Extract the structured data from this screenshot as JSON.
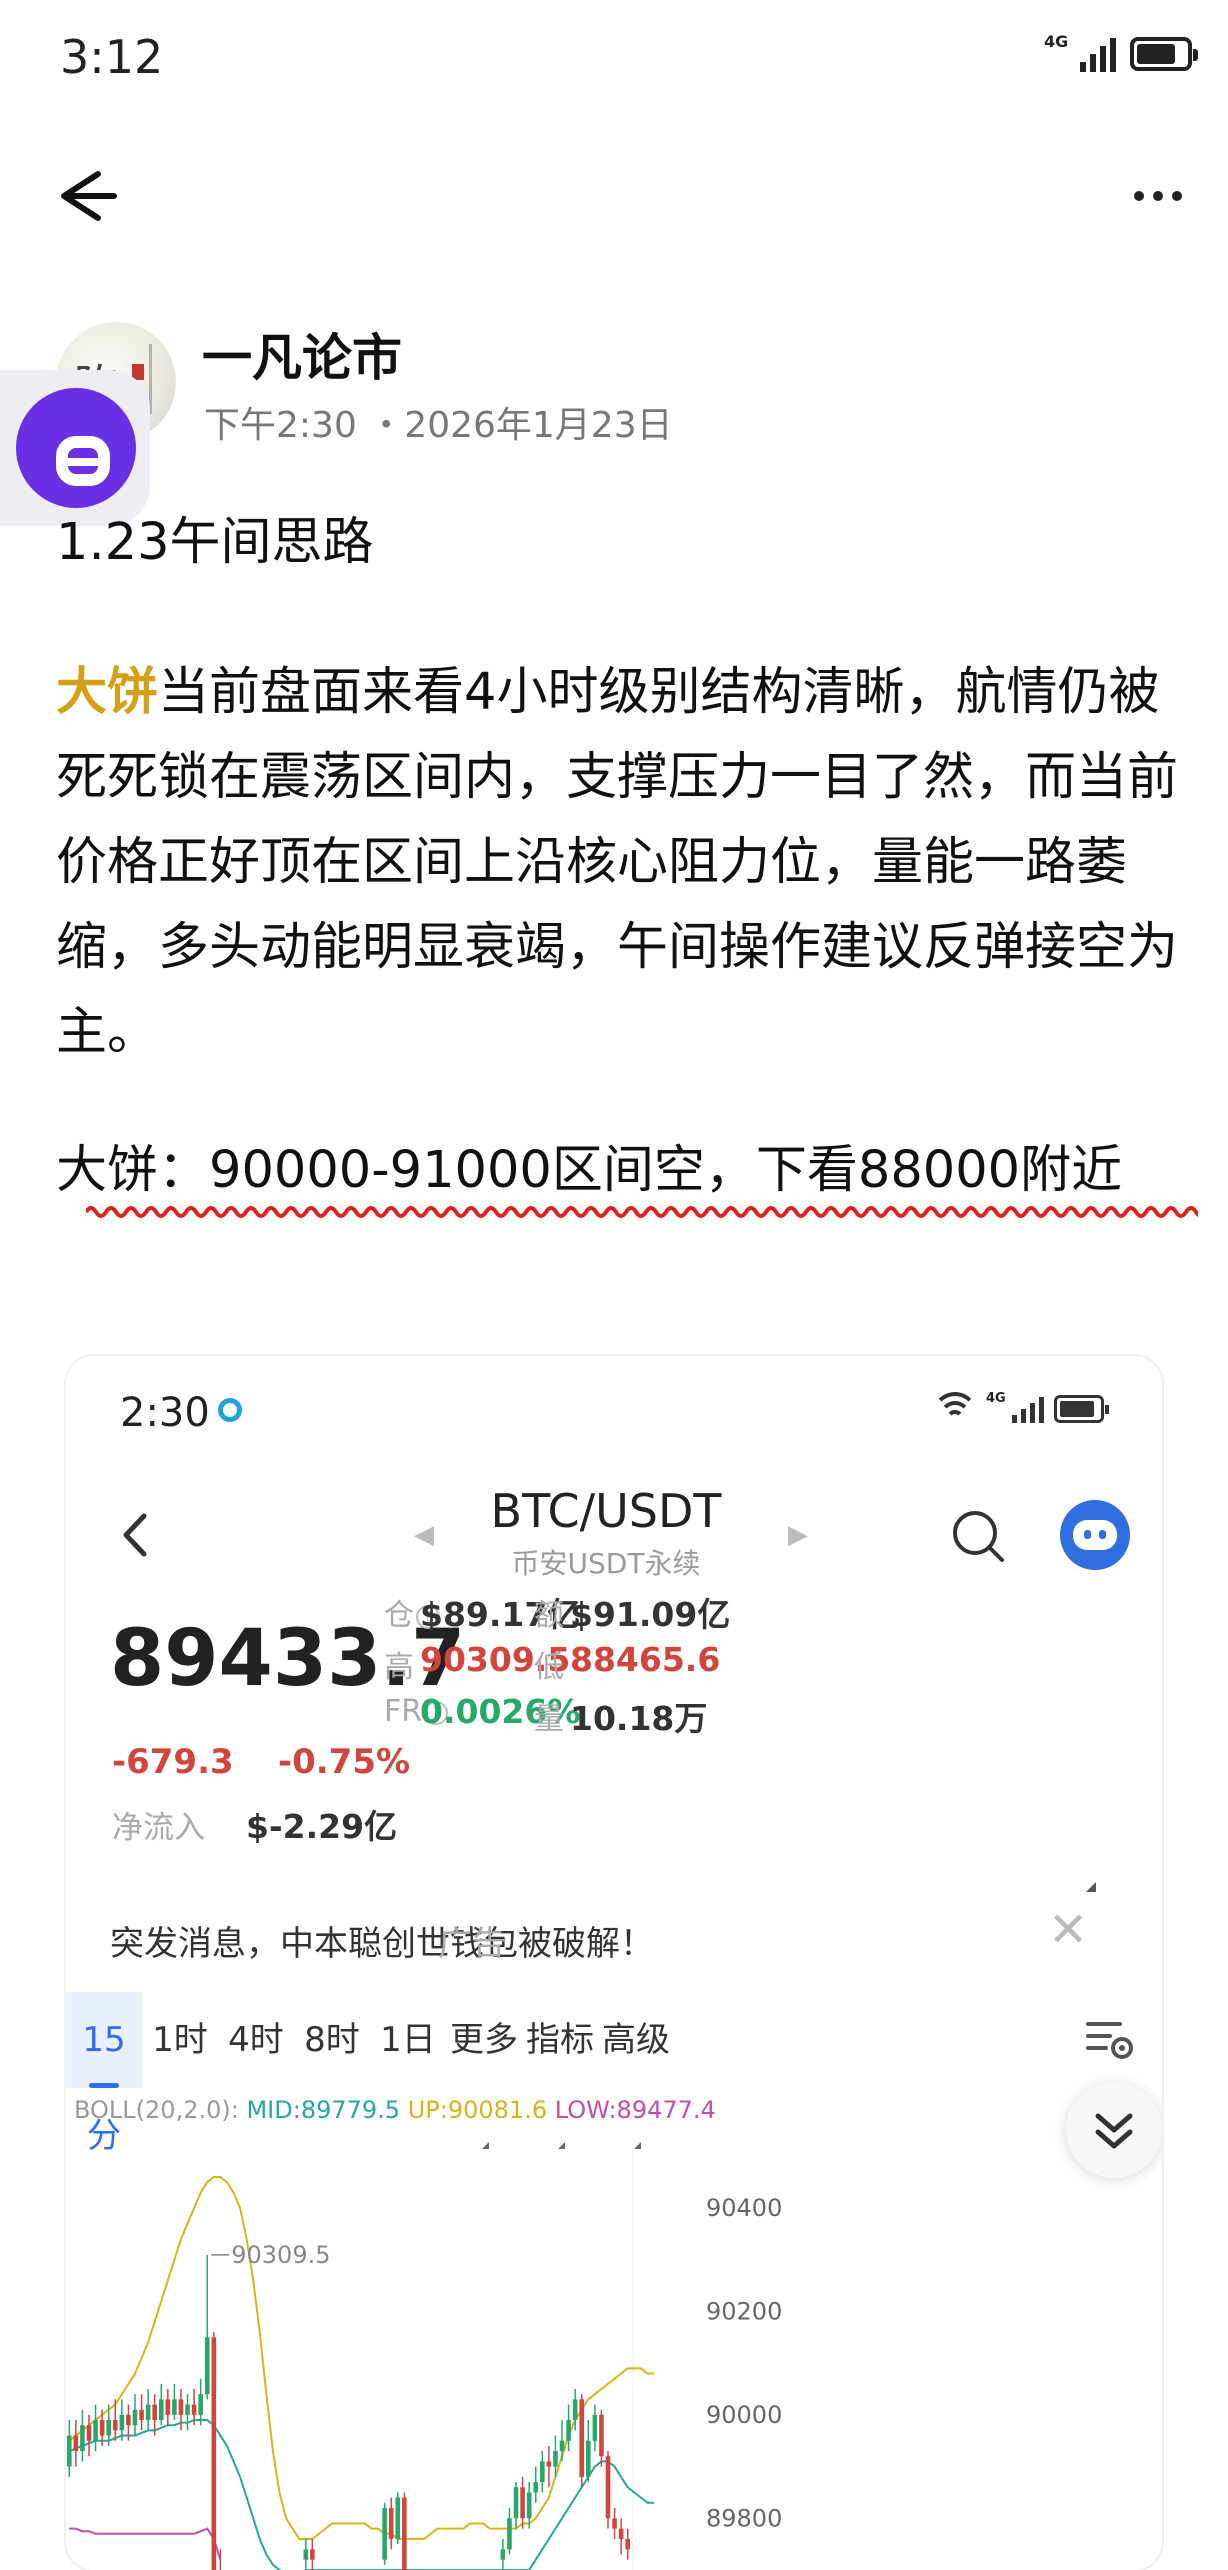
{
  "status_bar": {
    "time": "3:12",
    "network": "4G",
    "signal_bars": 4,
    "battery_level": 0.8
  },
  "author": {
    "name": "一凡论市",
    "meta": "下午2:30 ・2026年1月23日",
    "avatar_glyph": "陈"
  },
  "post": {
    "heading": "1.23午间思路",
    "highlight": "大饼",
    "body": "当前盘面来看4小时级别结构清晰，航情仍被死死锁在震荡区间内，支撑压力一目了然，而当前价格正好顶在区间上沿核心阻力位，量能一路萎缩，多头动能明显衰竭，午间操作建议反弹接空为主。",
    "call": "大饼：90000-91000区间空，下看88000附近"
  },
  "screenshot": {
    "status": {
      "time": "2:30",
      "network": "4G",
      "wifi_label": "6"
    },
    "pair": {
      "name": "BTC/USDT",
      "sub": "币安USDT永续"
    },
    "price": "89433.7",
    "change_abs": "-679.3",
    "change_pct": "-0.75%",
    "netflow_label": "净流入",
    "netflow_value": "$-2.29亿",
    "stats": {
      "oi_label": "仓",
      "oi_value": "$89.17亿",
      "turnover_label": "额",
      "turnover_value": "$91.09亿",
      "high_label": "高",
      "high_value": "90309.5",
      "low_label": "低",
      "low_value": "88465.6",
      "fr_label": "FR",
      "fr_value": "0.0026%",
      "volume_label": "量",
      "volume_value": "10.18万"
    },
    "news": {
      "text": "突发消息，中本聪创世钱包被破解！",
      "ad": "广告"
    },
    "tabs": [
      {
        "label": "15分",
        "active": true
      },
      {
        "label": "1时"
      },
      {
        "label": "4时"
      },
      {
        "label": "8时"
      },
      {
        "label": "1日"
      },
      {
        "label": "更多",
        "dropdown": true
      },
      {
        "label": "指标",
        "dropdown": true
      },
      {
        "label": "高级",
        "dropdown": true
      }
    ],
    "boll": {
      "prefix": "BOLL(20,2.0):",
      "mid": "MID:89779.5",
      "up": "UP:90081.6",
      "low": "LOW:89477.4"
    }
  },
  "chart_data": {
    "type": "candlestick",
    "indicator": "BOLL(20,2.0)",
    "y_ticks": [
      90400,
      90200,
      90000,
      89800
    ],
    "ylim": [
      89700,
      90520
    ],
    "high_marker": "90309.5",
    "colors": {
      "up": "#26a86b",
      "down": "#d2453d",
      "mid": "#25a6a3",
      "upper": "#d9b317",
      "lower": "#c44fa8"
    },
    "candles": [
      [
        89900,
        89960,
        89880,
        89990
      ],
      [
        89960,
        89930,
        89900,
        89990
      ],
      [
        89930,
        89980,
        89910,
        90010
      ],
      [
        89980,
        89950,
        89920,
        90000
      ],
      [
        89950,
        89990,
        89930,
        90020
      ],
      [
        89990,
        89960,
        89940,
        90010
      ],
      [
        89960,
        89990,
        89940,
        90020
      ],
      [
        89990,
        89970,
        89950,
        90030
      ],
      [
        89970,
        90000,
        89950,
        90030
      ],
      [
        90000,
        89980,
        89950,
        90020
      ],
      [
        89980,
        90010,
        89960,
        90040
      ],
      [
        90010,
        89990,
        89970,
        90040
      ],
      [
        89990,
        90020,
        89970,
        90050
      ],
      [
        90020,
        89990,
        89960,
        90040
      ],
      [
        89990,
        90030,
        89980,
        90060
      ],
      [
        90030,
        90000,
        89980,
        90050
      ],
      [
        90000,
        90030,
        89990,
        90060
      ],
      [
        90030,
        90000,
        89970,
        90050
      ],
      [
        90000,
        90020,
        89970,
        90040
      ],
      [
        90020,
        90000,
        89980,
        90050
      ],
      [
        90000,
        90040,
        89980,
        90070
      ],
      [
        90040,
        90150,
        90030,
        90309.5
      ],
      [
        90150,
        89700,
        89690,
        90160
      ],
      [
        89700,
        89690,
        89660,
        89740
      ],
      null,
      null,
      null,
      null,
      null,
      null,
      null,
      null,
      null,
      null,
      null,
      null,
      [
        89720,
        89740,
        89700,
        89760
      ],
      [
        89740,
        89720,
        89700,
        89760
      ],
      null,
      null,
      null,
      null,
      null,
      null,
      null,
      null,
      null,
      null,
      [
        89720,
        89820,
        89710,
        89830
      ],
      [
        89820,
        89760,
        89740,
        89840
      ],
      [
        89760,
        89840,
        89750,
        89850
      ],
      [
        89840,
        89700,
        89690,
        89850
      ],
      null,
      null,
      null,
      null,
      null,
      null,
      null,
      null,
      null,
      null,
      null,
      null,
      null,
      null,
      [
        89720,
        89740,
        89700,
        89760
      ],
      [
        89740,
        89800,
        89730,
        89820
      ],
      [
        89800,
        89860,
        89780,
        89870
      ],
      [
        89860,
        89800,
        89780,
        89880
      ],
      [
        89800,
        89850,
        89780,
        89870
      ],
      [
        89850,
        89870,
        89830,
        89900
      ],
      [
        89870,
        89910,
        89850,
        89930
      ],
      [
        89910,
        89900,
        89860,
        89940
      ],
      [
        89900,
        89930,
        89880,
        89960
      ],
      [
        89930,
        89950,
        89910,
        89990
      ],
      [
        89950,
        89990,
        89930,
        90020
      ],
      [
        89990,
        90030,
        89970,
        90050
      ],
      [
        90030,
        89880,
        89860,
        90040
      ],
      [
        89880,
        89950,
        89870,
        89990
      ],
      [
        89950,
        90000,
        89930,
        90020
      ],
      [
        90000,
        89920,
        89900,
        90010
      ],
      [
        89920,
        89800,
        89780,
        89930
      ],
      [
        89800,
        89780,
        89760,
        89820
      ],
      [
        89780,
        89760,
        89730,
        89800
      ],
      [
        89760,
        89740,
        89720,
        89780
      ]
    ],
    "upper_band": [
      89950,
      89960,
      89970,
      89980,
      89990,
      90000,
      90010,
      90020,
      90040,
      90060,
      90080,
      90110,
      90140,
      90180,
      90220,
      90260,
      90300,
      90340,
      90370,
      90400,
      90430,
      90450,
      90460,
      90460,
      90450,
      90430,
      90400,
      90340,
      90260,
      90160,
      90040,
      89930,
      89850,
      89800,
      89780,
      89760,
      89760,
      89760,
      89770,
      89780,
      89790,
      89790,
      89790,
      89790,
      89790,
      89790,
      89780,
      89780,
      89770,
      89770,
      89760,
      89760,
      89760,
      89760,
      89760,
      89770,
      89780,
      89780,
      89780,
      89780,
      89780,
      89790,
      89790,
      89790,
      89780,
      89780,
      89780,
      89780,
      89780,
      89790,
      89790,
      89800,
      89820,
      89840,
      89880,
      89920,
      89960,
      89990,
      90010,
      90030,
      90040,
      90050,
      90060,
      90070,
      90080,
      90090,
      90090,
      90090,
      90080,
      90080
    ],
    "middle_band": [
      89930,
      89935,
      89940,
      89945,
      89950,
      89950,
      89950,
      89955,
      89960,
      89960,
      89960,
      89965,
      89970,
      89970,
      89975,
      89980,
      89980,
      89985,
      89985,
      89990,
      89990,
      89990,
      89980,
      89960,
      89940,
      89910,
      89880,
      89840,
      89800,
      89760,
      89730,
      89710,
      89700,
      89690,
      89690,
      89690,
      89700,
      89700,
      89700,
      89700,
      89700,
      89700,
      89700,
      89700,
      89700,
      89700,
      89700,
      89700,
      89700,
      89700,
      89700,
      89700,
      89700,
      89700,
      89700,
      89700,
      89700,
      89700,
      89700,
      89700,
      89700,
      89700,
      89700,
      89700,
      89700,
      89700,
      89700,
      89700,
      89700,
      89700,
      89700,
      89720,
      89740,
      89760,
      89780,
      89800,
      89820,
      89840,
      89860,
      89880,
      89900,
      89910,
      89910,
      89900,
      89880,
      89860,
      89850,
      89840,
      89830,
      89830
    ],
    "lower_band": [
      89780,
      89780,
      89775,
      89775,
      89770,
      89770,
      89770,
      89770,
      89770,
      89770,
      89770,
      89770,
      89770,
      89770,
      89770,
      89770,
      89770,
      89770,
      89770,
      89770,
      89775,
      89780,
      89760,
      89720
    ]
  }
}
